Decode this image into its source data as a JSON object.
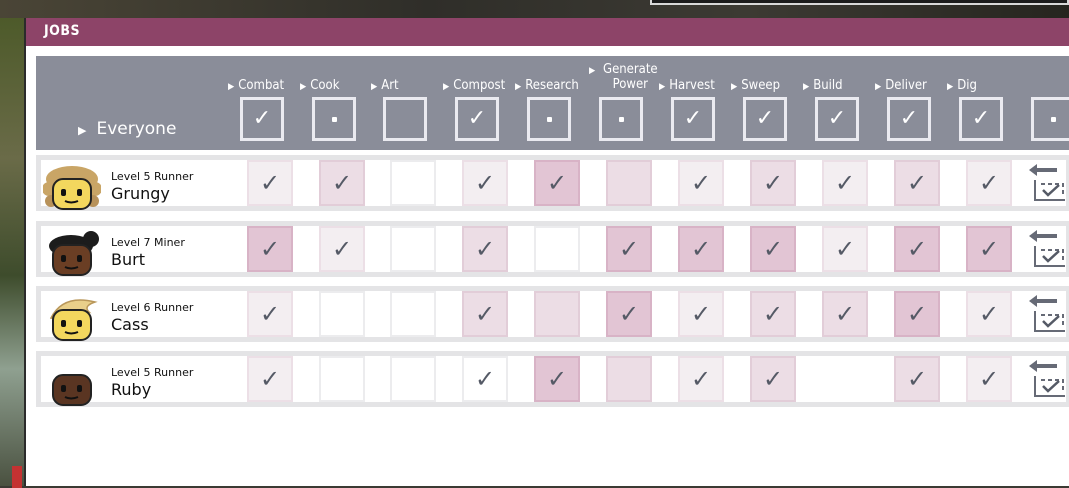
{
  "window": {
    "title": "JOBS"
  },
  "header": {
    "everyone_label": "Everyone",
    "columns": [
      {
        "label": "Combat",
        "state": "check"
      },
      {
        "label": "Cook",
        "state": "dot"
      },
      {
        "label": "Art",
        "state": "empty"
      },
      {
        "label": "Compost",
        "state": "check"
      },
      {
        "label": "Research",
        "state": "dot"
      },
      {
        "label_line1": "Generate",
        "label": "Power",
        "state": "dot"
      },
      {
        "label": "Harvest",
        "state": "check"
      },
      {
        "label": "Sweep",
        "state": "check"
      },
      {
        "label": "Build",
        "state": "check"
      },
      {
        "label": "Deliver",
        "state": "check"
      },
      {
        "label": "Dig",
        "state": "check"
      },
      {
        "label": "",
        "state": "dot"
      }
    ]
  },
  "rows": [
    {
      "role": "Level 5 Runner",
      "name": "Grungy",
      "hair": "blond-curly",
      "skin": "#f3d75e",
      "cells": [
        [
          1,
          true
        ],
        [
          2,
          true
        ],
        [
          0,
          false
        ],
        [
          1,
          true
        ],
        [
          3,
          true
        ],
        [
          2,
          false
        ],
        [
          1,
          true
        ],
        [
          2,
          true
        ],
        [
          1,
          true
        ],
        [
          2,
          true
        ],
        [
          1,
          true
        ]
      ]
    },
    {
      "role": "Level 7 Miner",
      "name": "Burt",
      "hair": "dark-bun",
      "skin": "#6a3e24",
      "cells": [
        [
          3,
          true
        ],
        [
          1,
          true
        ],
        [
          0,
          false
        ],
        [
          2,
          true
        ],
        [
          0,
          false
        ],
        [
          3,
          true
        ],
        [
          3,
          true
        ],
        [
          3,
          true
        ],
        [
          1,
          true
        ],
        [
          3,
          true
        ],
        [
          3,
          true
        ]
      ]
    },
    {
      "role": "Level 6 Runner",
      "name": "Cass",
      "hair": "blond-swoop",
      "skin": "#f3d75e",
      "cells": [
        [
          1,
          true
        ],
        [
          0,
          false
        ],
        [
          0,
          false
        ],
        [
          2,
          true
        ],
        [
          2,
          false
        ],
        [
          3,
          true
        ],
        [
          1,
          true
        ],
        [
          2,
          true
        ],
        [
          2,
          true
        ],
        [
          3,
          true
        ],
        [
          1,
          true
        ]
      ]
    },
    {
      "role": "Level 5 Runner",
      "name": "Ruby",
      "hair": "bald",
      "skin": "#5a3522",
      "cells": [
        [
          1,
          true
        ],
        [
          0,
          false
        ],
        [
          0,
          false
        ],
        [
          0,
          true
        ],
        [
          3,
          true
        ],
        [
          2,
          false
        ],
        [
          1,
          true
        ],
        [
          2,
          true
        ],
        [
          -1,
          false
        ],
        [
          2,
          true
        ],
        [
          1,
          true
        ]
      ]
    }
  ],
  "icons": {
    "check": "check-icon",
    "dot": "dot-icon",
    "triangle": "triangle-right-icon",
    "row_action": "copy-settings-icon"
  },
  "colors": {
    "title_bar": "#8d4468",
    "header_bg": "#8a8d99",
    "check": "#555a66"
  }
}
